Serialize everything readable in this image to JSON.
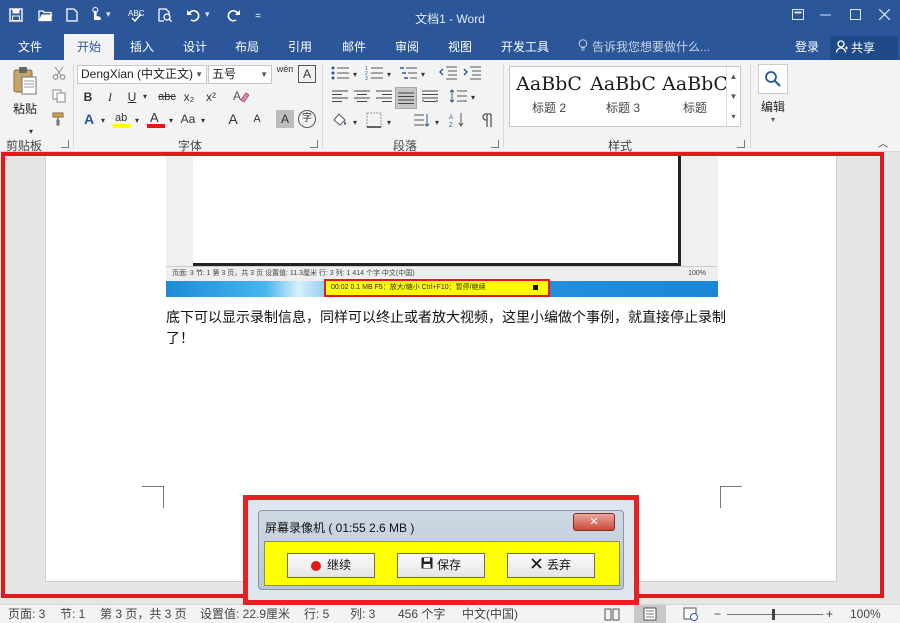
{
  "app": {
    "window_title": "文档1 - Word"
  },
  "quick_access": {
    "icons": [
      "save-icon",
      "open-icon",
      "new-doc-icon",
      "touch-mode-icon",
      "spelling-icon",
      "print-preview-icon",
      "undo-icon",
      "redo-icon",
      "customize-icon"
    ]
  },
  "tabs": [
    {
      "label": "文件"
    },
    {
      "label": "开始"
    },
    {
      "label": "插入"
    },
    {
      "label": "设计"
    },
    {
      "label": "布局"
    },
    {
      "label": "引用"
    },
    {
      "label": "邮件"
    },
    {
      "label": "审阅"
    },
    {
      "label": "视图"
    },
    {
      "label": "开发工具"
    }
  ],
  "tell_me": "告诉我您想要做什么...",
  "account": {
    "login": "登录",
    "share": "共享"
  },
  "ribbon": {
    "clipboard": {
      "paste": "粘贴",
      "label": "剪贴板"
    },
    "font": {
      "font_name": "DengXian (中文正文)",
      "font_size": "五号",
      "label": "字体",
      "bold": "B",
      "italic": "I",
      "underline": "U",
      "strike": "abc",
      "subscript": "x₂",
      "superscript": "x²",
      "grow": "A",
      "shrink": "A",
      "case": "Aa",
      "phonetic": "wén",
      "border_char": "A",
      "enclose": "字",
      "shade": "A"
    },
    "paragraph": {
      "label": "段落"
    },
    "styles": {
      "label": "样式",
      "items": [
        {
          "sample": "AaBbC",
          "name": "标题 2"
        },
        {
          "sample": "AaBbC",
          "name": "标题 3"
        },
        {
          "sample": "AaBbC",
          "name": "标题"
        }
      ]
    },
    "editing": {
      "label": "编辑"
    }
  },
  "document": {
    "embedded_statusbar": "页面: 3    节: 1    第 3 页，共 3 页    设置值: 11.3厘米    行: 3    列: 1    414 个字    中文(中国)",
    "embedded_recorder": "00:02    0.1 MB    F5：放大/缩小  Ctrl+F10：暂停/继续",
    "embedded_zoom": "100%",
    "paragraph": "底下可以显示录制信息，同样可以终止或者放大视频，这里小编做个事例，就直接停止录制了！"
  },
  "statusbar": {
    "page": "页面: 3",
    "section": "节: 1",
    "pages": "第 3 页，共 3 页",
    "position": "设置值: 22.9厘米",
    "line": "行: 5",
    "column": "列: 3",
    "words": "456 个字",
    "language": "中文(中国)",
    "zoom": "100%"
  },
  "recorder": {
    "title": "屏幕录像机 ( 01:55   2.6 MB )",
    "close": "✕",
    "buttons": {
      "continue": "继续",
      "save": "保存",
      "discard": "丢弃"
    }
  },
  "colors": {
    "word_blue": "#2b579a",
    "highlight_red": "#e01a1a",
    "recorder_yellow": "#ffff00"
  }
}
